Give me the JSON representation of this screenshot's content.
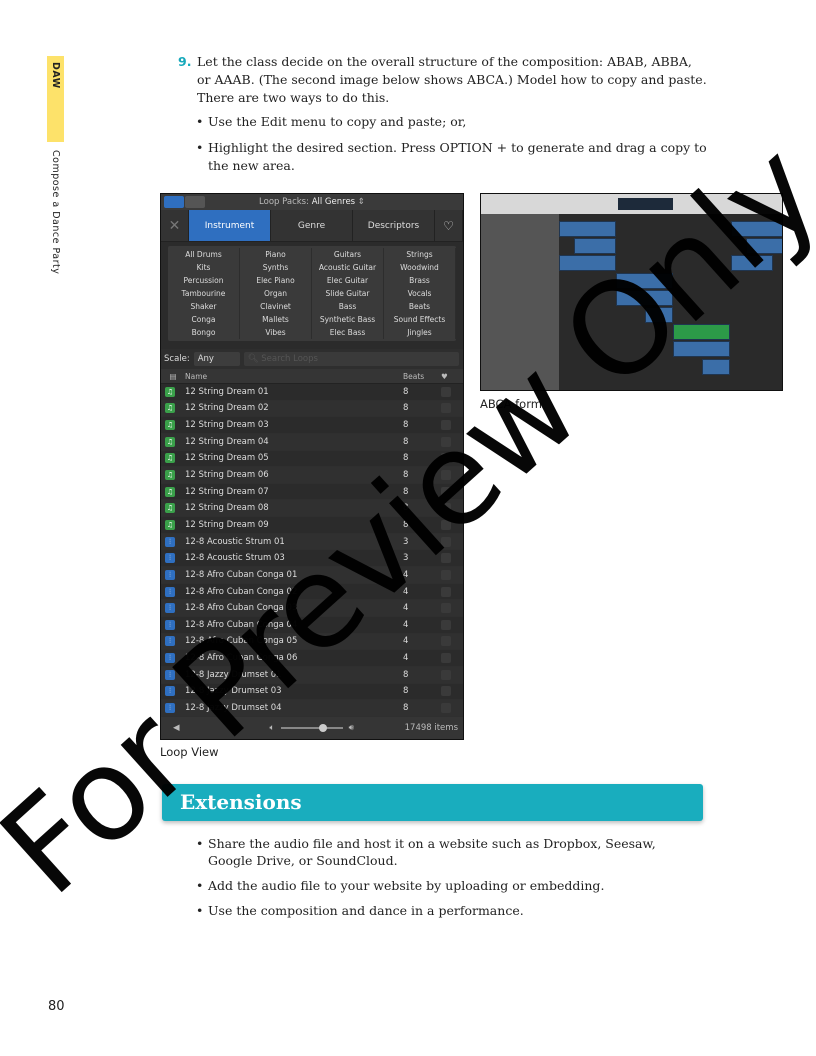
{
  "sidebar": {
    "section": "DAW",
    "chapter": "Compose a Dance Party"
  },
  "step": {
    "number": "9.",
    "text": "Let the class decide on the overall structure of the composition: ABAB, ABBA, or AAAB. (The second image below shows ABCA.) Model how to copy and paste. There are two ways to do this.",
    "bullets": [
      "Use the Edit menu to copy and paste; or,",
      "Highlight the desired section. Press OPTION + to generate and drag a copy to the new area."
    ]
  },
  "loop_browser": {
    "loop_packs_label": "Loop Packs:",
    "loop_packs_value": "All Genres",
    "tabs": [
      "Instrument",
      "Genre",
      "Descriptors"
    ],
    "instruments": [
      "All Drums",
      "Piano",
      "Guitars",
      "Strings",
      "Kits",
      "Synths",
      "Acoustic Guitar",
      "Woodwind",
      "Percussion",
      "Elec Piano",
      "Elec Guitar",
      "Brass",
      "Tambourine",
      "Organ",
      "Slide Guitar",
      "Vocals",
      "Shaker",
      "Clavinet",
      "Bass",
      "Beats",
      "Conga",
      "Mallets",
      "Synthetic Bass",
      "Sound Effects",
      "Bongo",
      "Vibes",
      "Elec Bass",
      "Jingles"
    ],
    "scale_label": "Scale:",
    "scale_value": "Any",
    "search_placeholder": "Search Loops",
    "columns": {
      "name": "Name",
      "beats": "Beats"
    },
    "loops": [
      {
        "name": "12 String Dream 01",
        "beats": "8",
        "type": "midi"
      },
      {
        "name": "12 String Dream 02",
        "beats": "8",
        "type": "midi"
      },
      {
        "name": "12 String Dream 03",
        "beats": "8",
        "type": "midi"
      },
      {
        "name": "12 String Dream 04",
        "beats": "8",
        "type": "midi"
      },
      {
        "name": "12 String Dream 05",
        "beats": "8",
        "type": "midi"
      },
      {
        "name": "12 String Dream 06",
        "beats": "8",
        "type": "midi"
      },
      {
        "name": "12 String Dream 07",
        "beats": "8",
        "type": "midi"
      },
      {
        "name": "12 String Dream 08",
        "beats": "8",
        "type": "midi"
      },
      {
        "name": "12 String Dream 09",
        "beats": "8",
        "type": "midi"
      },
      {
        "name": "12-8 Acoustic Strum 01",
        "beats": "3",
        "type": "audio"
      },
      {
        "name": "12-8 Acoustic Strum 03",
        "beats": "3",
        "type": "audio"
      },
      {
        "name": "12-8 Afro Cuban Conga 01",
        "beats": "4",
        "type": "audio"
      },
      {
        "name": "12-8 Afro Cuban Conga 02",
        "beats": "4",
        "type": "audio"
      },
      {
        "name": "12-8 Afro Cuban Conga 03",
        "beats": "4",
        "type": "audio"
      },
      {
        "name": "12-8 Afro Cuban Conga 04",
        "beats": "4",
        "type": "audio"
      },
      {
        "name": "12-8 Afro Cuban Conga 05",
        "beats": "4",
        "type": "audio"
      },
      {
        "name": "12-8 Afro Cuban Conga 06",
        "beats": "4",
        "type": "audio"
      },
      {
        "name": "12-8 Jazzy Drumset 01",
        "beats": "8",
        "type": "audio"
      },
      {
        "name": "12-8 Jazzy Drumset 03",
        "beats": "8",
        "type": "audio"
      },
      {
        "name": "12-8 Jazzy Drumset 04",
        "beats": "8",
        "type": "audio"
      }
    ],
    "item_count": "17498 items",
    "colors": {
      "midi": "#3aa04a",
      "audio": "#2f6fc0",
      "selected_tab": "#2f6fc0"
    }
  },
  "captions": {
    "loop_view": "Loop View",
    "abca": "ABCA form"
  },
  "extensions": {
    "title": "Extensions",
    "bullets": [
      "Share the audio file and host it on a website such as Dropbox, Seesaw, Google Drive, or SoundCloud.",
      "Add the audio file to your website by uploading or embedding.",
      "Use the composition and dance in a performance."
    ],
    "color": "#19adbe"
  },
  "page_number": "80",
  "watermark": "For Preview Only"
}
